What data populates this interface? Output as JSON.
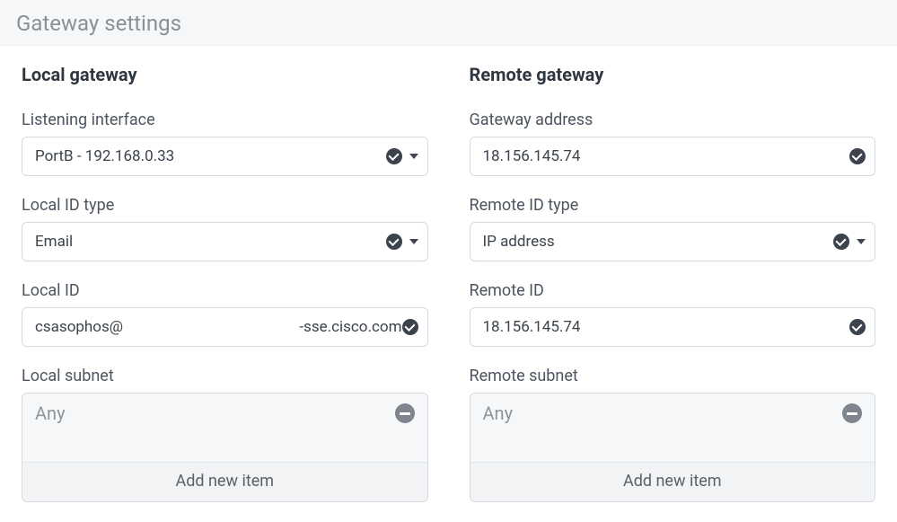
{
  "page_title": "Gateway settings",
  "local": {
    "heading": "Local gateway",
    "listening_interface": {
      "label": "Listening interface",
      "value": "PortB - 192.168.0.33"
    },
    "id_type": {
      "label": "Local ID type",
      "value": "Email"
    },
    "id": {
      "label": "Local ID",
      "value_left": "csasophos@",
      "value_right": "-sse.cisco.com"
    },
    "subnet": {
      "label": "Local subnet",
      "entry": "Any",
      "add_label": "Add new item"
    }
  },
  "remote": {
    "heading": "Remote gateway",
    "gateway_address": {
      "label": "Gateway address",
      "value": "18.156.145.74"
    },
    "id_type": {
      "label": "Remote ID type",
      "value": "IP address"
    },
    "id": {
      "label": "Remote ID",
      "value": "18.156.145.74"
    },
    "subnet": {
      "label": "Remote subnet",
      "entry": "Any",
      "add_label": "Add new item"
    }
  }
}
